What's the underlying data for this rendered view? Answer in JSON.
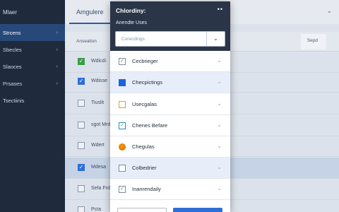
{
  "sidebar": {
    "app_title": "Mlaer",
    "items": [
      {
        "label": "Strcens",
        "chev": "›",
        "active": true
      },
      {
        "label": "Sbecles",
        "chev": "›"
      },
      {
        "label": "Slaoces",
        "chev": "›"
      },
      {
        "label": "Prsases",
        "chev": "›"
      },
      {
        "label": "Tsectiinis",
        "chev": ""
      }
    ]
  },
  "main": {
    "title": "Amgulere",
    "head_chevron": "⌄",
    "subbar_label": "Anseation",
    "subbar_button": "Sepd",
    "rows": [
      {
        "label": "Wdicdi",
        "check": "✓",
        "state": "green"
      },
      {
        "label": "Wdisse",
        "check": "✓",
        "state": "blue"
      },
      {
        "label": "Tiuslit",
        "check": "",
        "state": "empty"
      },
      {
        "label": "sgot Mrd",
        "check": "",
        "state": "empty"
      },
      {
        "label": "Wdert",
        "check": "",
        "state": "empty"
      },
      {
        "label": "Mdesa",
        "check": "✓",
        "state": "blue"
      },
      {
        "label": "Sefa Frd",
        "check": "",
        "state": "empty"
      },
      {
        "label": "Pcta",
        "check": "",
        "state": "empty"
      }
    ]
  },
  "modal": {
    "title": "Chlordiny:",
    "more_icon": "••",
    "subtitle": "Anendte Uses",
    "search_placeholder": "Corecdings",
    "search_chevron": "⌄",
    "options": [
      {
        "label": "Cecbrieger",
        "check": "✓",
        "style": "green"
      },
      {
        "label": "Checpictings",
        "check": "✓",
        "style": "blue"
      },
      {
        "label": "Usecgalas",
        "check": "",
        "style": "orange"
      },
      {
        "label": "Chenes Befare",
        "check": "✓",
        "style": "teal"
      },
      {
        "label": "Chegulas",
        "check": "",
        "style": "circle"
      },
      {
        "label": "Colbedrier",
        "check": "",
        "style": "empty"
      },
      {
        "label": "Inanrendaily",
        "check": "✓",
        "style": "green"
      }
    ],
    "option_chevron": "⌄"
  }
}
